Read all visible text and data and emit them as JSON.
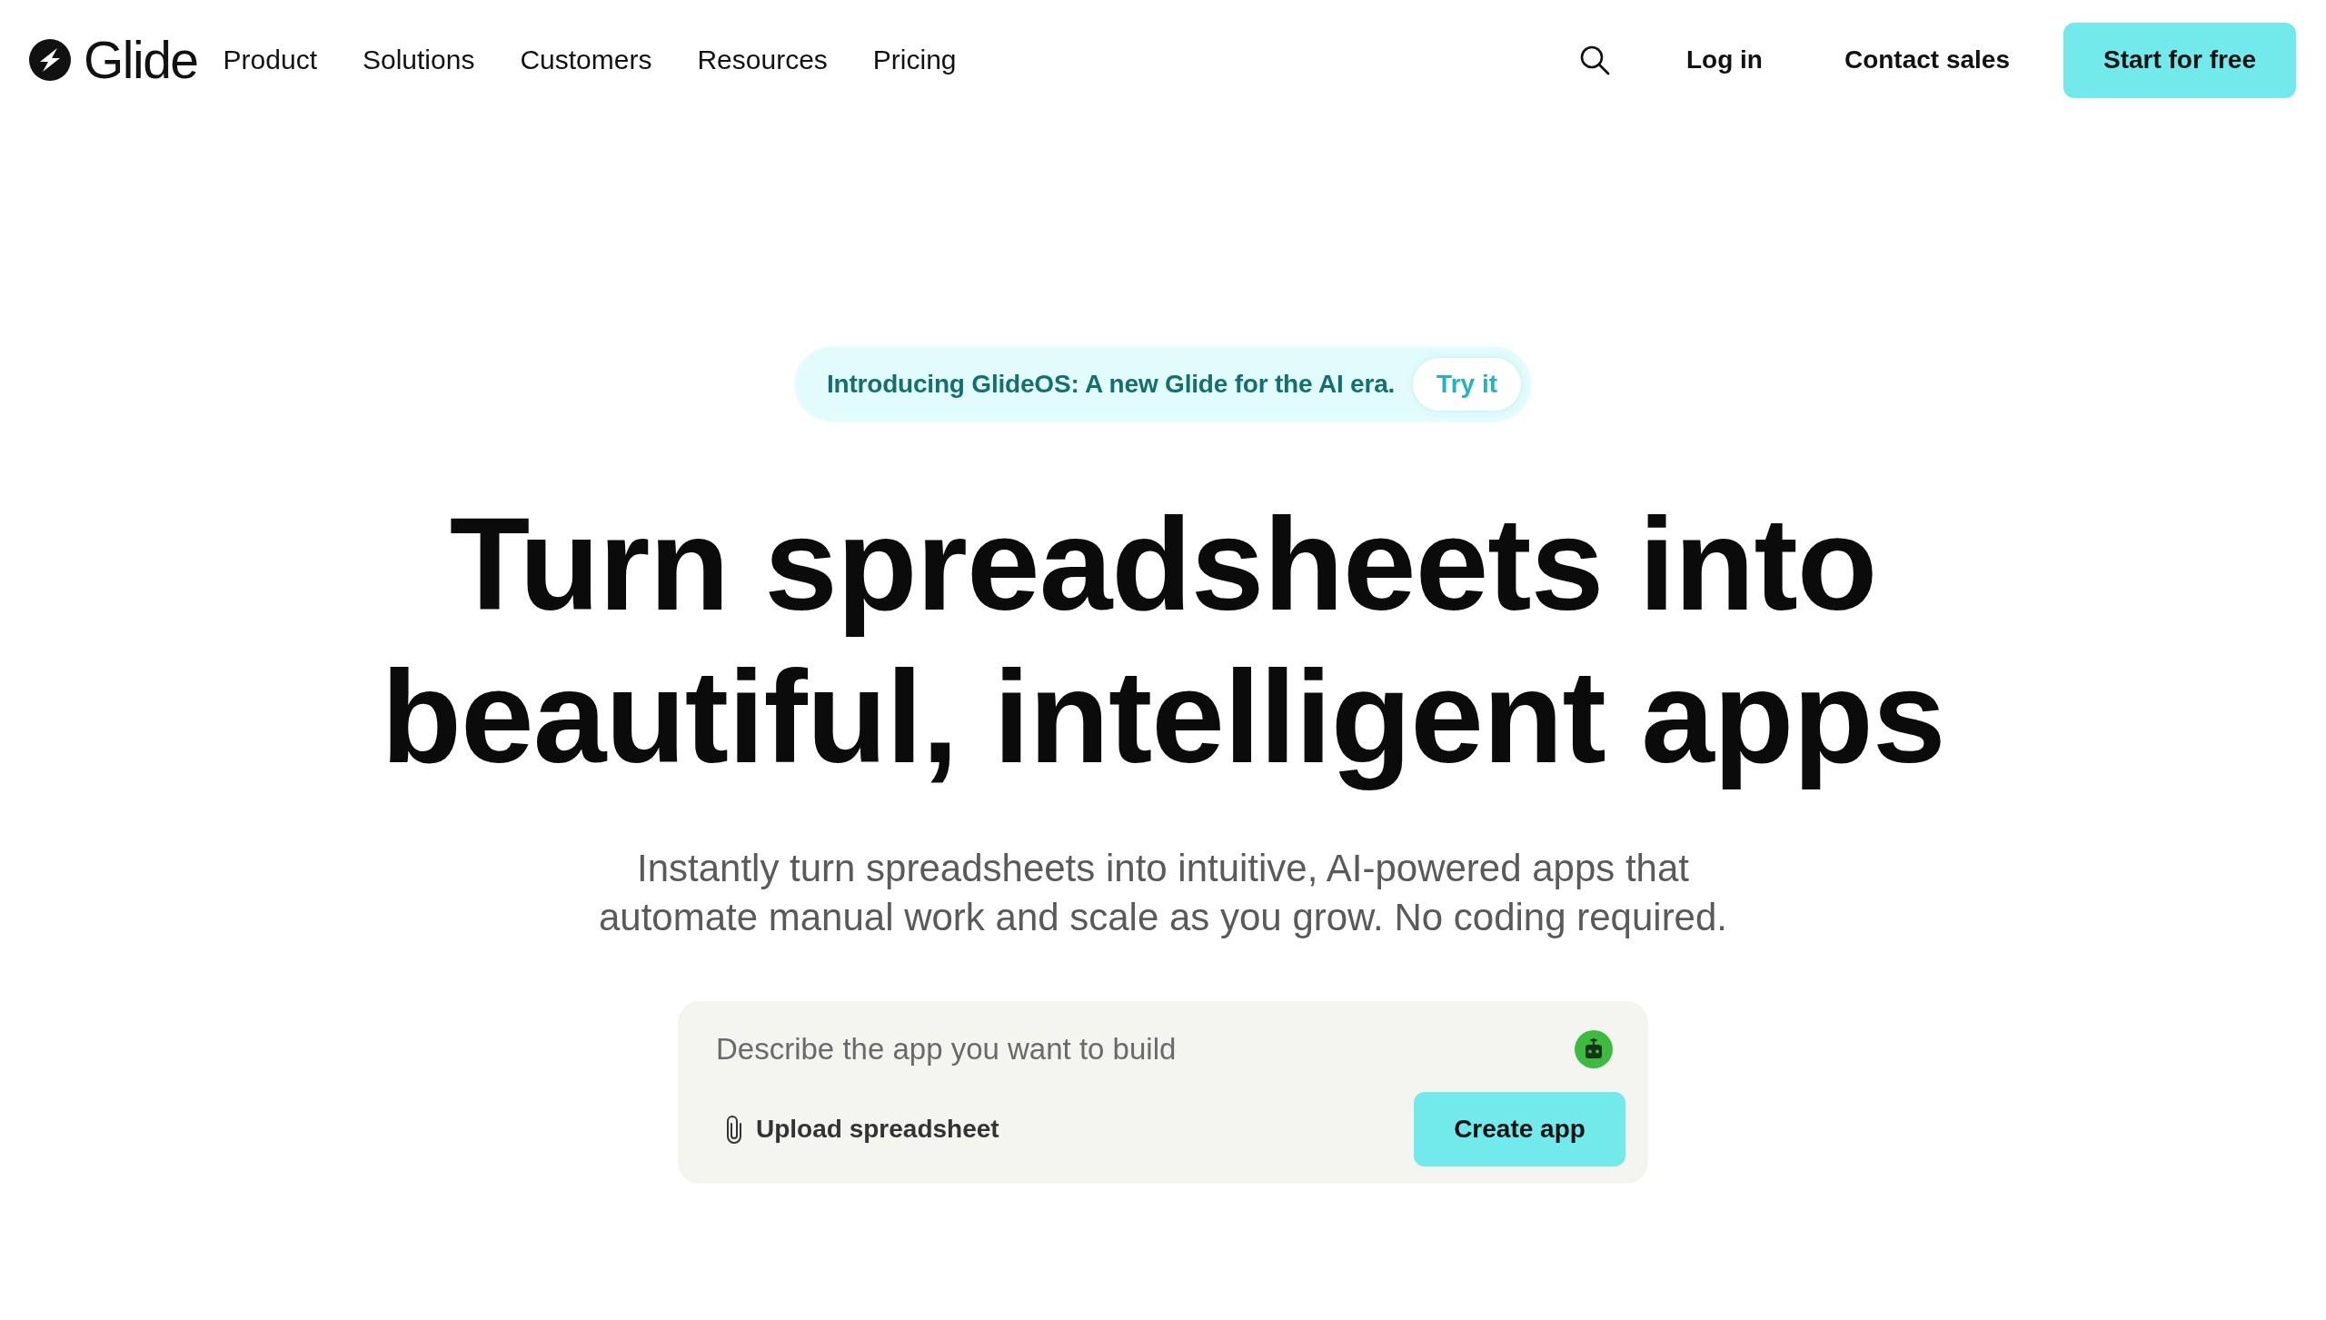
{
  "nav": {
    "logo": "Glide",
    "links": [
      "Product",
      "Solutions",
      "Customers",
      "Resources",
      "Pricing"
    ],
    "login": "Log in",
    "contact": "Contact sales",
    "cta": "Start for free"
  },
  "announcement": {
    "text": "Introducing GlideOS: A new Glide for the AI era.",
    "action": "Try it"
  },
  "hero": {
    "title": "Turn spreadsheets into beautiful, intelligent apps",
    "subtitle": "Instantly turn spreadsheets into intuitive, AI-powered apps that automate manual work and scale as you grow. No coding required."
  },
  "prompt": {
    "placeholder": "Describe the app you want to build",
    "upload": "Upload spreadsheet",
    "submit": "Create app"
  }
}
